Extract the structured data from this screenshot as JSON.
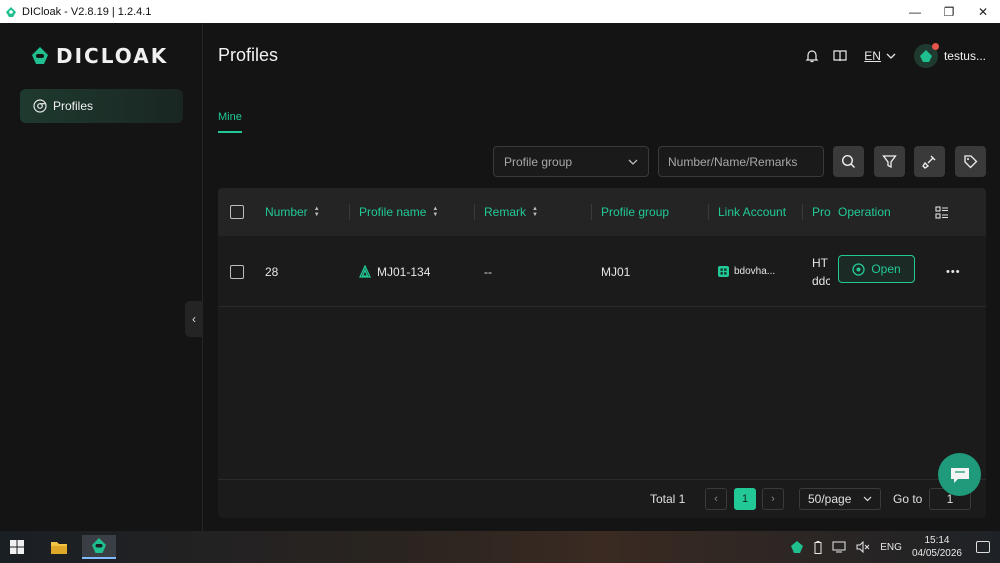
{
  "window": {
    "title": "DICloak - V2.8.19 | 1.2.4.1",
    "minimize": "—",
    "maximize": "❐",
    "close": "✕"
  },
  "sidebar": {
    "logo_text": "DICLOAK",
    "items": [
      {
        "label": "Profiles",
        "icon": "chrome-icon",
        "active": true
      }
    ],
    "collapse": "‹"
  },
  "header": {
    "title": "Profiles",
    "language": "EN",
    "username": "testus..."
  },
  "tabs": [
    {
      "label": "Mine",
      "active": true
    }
  ],
  "filters": {
    "profile_group_placeholder": "Profile group",
    "search_placeholder": "Number/Name/Remarks"
  },
  "table": {
    "columns": [
      "Number",
      "Profile name",
      "Remark",
      "Profile group",
      "Link Account",
      "Pro",
      "Operation"
    ],
    "rows": [
      {
        "number": "28",
        "profile_name": "MJ01-134",
        "remark": "--",
        "profile_group": "MJ01",
        "link_account": "bdovha...",
        "proxy_line1": "HT",
        "proxy_line2": "ddc",
        "open_label": "Open",
        "more": "•••"
      }
    ]
  },
  "pagination": {
    "total_label": "Total 1",
    "prev": "‹",
    "current_page": "1",
    "next": "›",
    "page_size": "50/page",
    "goto_label": "Go to",
    "goto_value": "1"
  },
  "taskbar": {
    "language": "ENG",
    "time": "15:14",
    "date": "04/05/2026"
  },
  "colors": {
    "accent": "#22c997",
    "background": "#141414",
    "panel": "#1b1b1b"
  }
}
